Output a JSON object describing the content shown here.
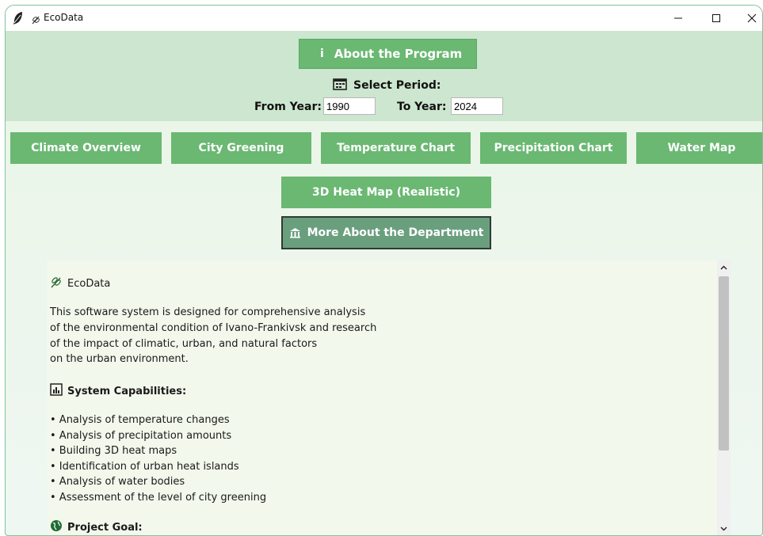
{
  "window": {
    "title": "EcoData"
  },
  "header": {
    "about_label": "About the Program",
    "about_icon_glyph": "i",
    "period_label": "Select Period:",
    "from_label": "From Year:",
    "from_value": "1990",
    "to_label": "To Year:",
    "to_value": "2024"
  },
  "nav": {
    "buttons": [
      "Climate Overview",
      "City Greening",
      "Temperature Chart",
      "Precipitation Chart",
      "Water Map"
    ],
    "heat_map_label": "3D Heat Map (Realistic)",
    "department_label": "More About the Department"
  },
  "content": {
    "title": "EcoData",
    "intro_lines": [
      "This software system is designed for comprehensive analysis",
      "of the environmental condition of Ivano-Frankivsk and research",
      "of the impact of climatic, urban, and natural factors",
      "on the urban environment."
    ],
    "capabilities_heading": "System Capabilities:",
    "capabilities": [
      "• Analysis of temperature changes",
      "• Analysis of precipitation amounts",
      "• Building 3D heat maps",
      "• Identification of urban heat islands",
      "• Analysis of water bodies",
      "• Assessment of the level of city greening"
    ],
    "goal_heading": "Project Goal:"
  },
  "colors": {
    "button_green": "#6ab872",
    "department_button": "#6a9f7e",
    "header_band": "#cde6cf",
    "panel_bg": "#f2f8ec"
  },
  "icons": {
    "app": "feather-icon",
    "title": "wheat-icon",
    "about": "info-icon",
    "period": "calendar-icon",
    "department": "building-icon",
    "content_title": "wheat-icon",
    "capabilities": "bar-chart-icon",
    "goal": "globe-icon"
  }
}
